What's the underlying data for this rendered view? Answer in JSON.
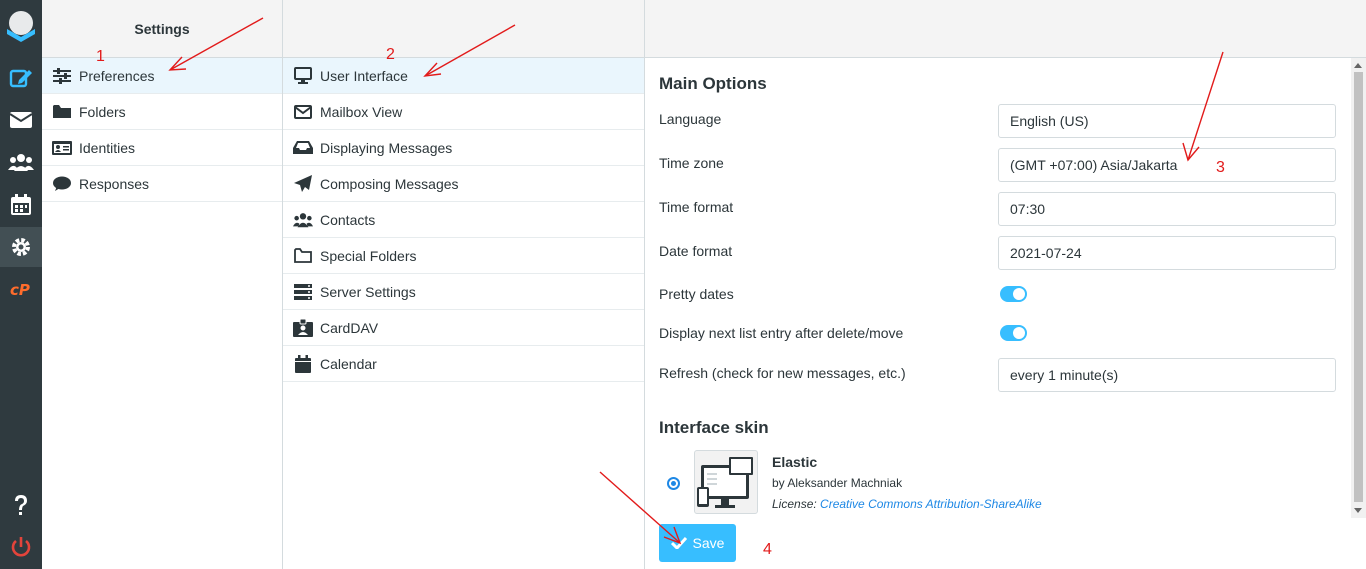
{
  "settings_title": "Settings",
  "sections": [
    {
      "label": "Preferences",
      "icon": "sliders-icon"
    },
    {
      "label": "Folders",
      "icon": "folder-icon"
    },
    {
      "label": "Identities",
      "icon": "id-card-icon"
    },
    {
      "label": "Responses",
      "icon": "comment-icon"
    }
  ],
  "preferences": [
    {
      "label": "User Interface",
      "icon": "monitor-icon"
    },
    {
      "label": "Mailbox View",
      "icon": "envelope-icon"
    },
    {
      "label": "Displaying Messages",
      "icon": "inbox-icon"
    },
    {
      "label": "Composing Messages",
      "icon": "paper-plane-icon"
    },
    {
      "label": "Contacts",
      "icon": "users-icon"
    },
    {
      "label": "Special Folders",
      "icon": "folder-outline-icon"
    },
    {
      "label": "Server Settings",
      "icon": "server-icon"
    },
    {
      "label": "CardDAV",
      "icon": "address-card-icon"
    },
    {
      "label": "Calendar",
      "icon": "calendar-icon"
    }
  ],
  "main": {
    "heading": "Main Options",
    "language_label": "Language",
    "language_value": "English (US)",
    "timezone_label": "Time zone",
    "timezone_value": "(GMT +07:00) Asia/Jakarta",
    "timeformat_label": "Time format",
    "timeformat_value": "07:30",
    "dateformat_label": "Date format",
    "dateformat_value": "2021-07-24",
    "prettydates_label": "Pretty dates",
    "prettydates_on": true,
    "nextentry_label": "Display next list entry after delete/move",
    "nextentry_on": true,
    "refresh_label": "Refresh (check for new messages, etc.)",
    "refresh_value": "every 1 minute(s)"
  },
  "skin": {
    "heading": "Interface skin",
    "name": "Elastic",
    "author": "by Aleksander Machniak",
    "license_prefix": "License:",
    "license_link": "Creative Commons Attribution-ShareAlike"
  },
  "save_label": "Save",
  "annotations": {
    "n1": "1",
    "n2": "2",
    "n3": "3",
    "n4": "4"
  },
  "colors": {
    "accent": "#37beff",
    "rail": "#2f3a3f",
    "annotation": "#e21b1b",
    "selected_row": "#eaf6fd"
  }
}
